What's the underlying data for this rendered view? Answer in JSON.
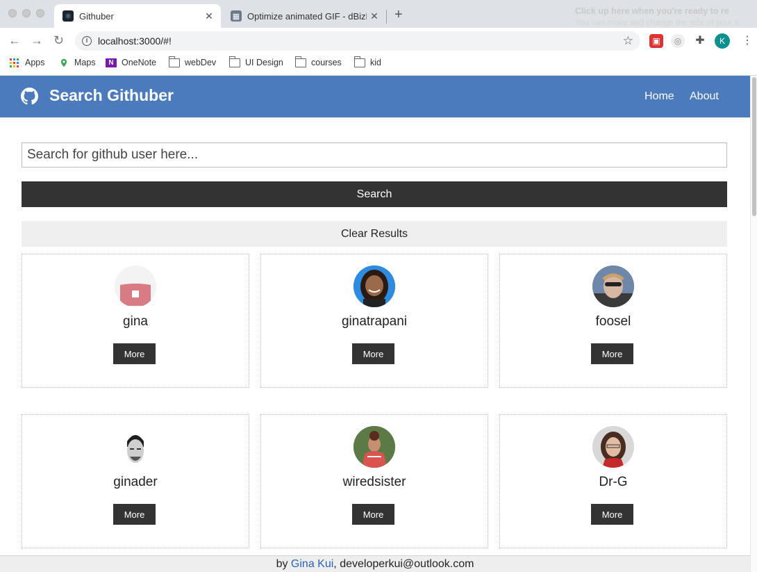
{
  "browser": {
    "tabs": [
      {
        "title": "Githuber",
        "active": true
      },
      {
        "title": "Optimize animated GIF - dBizE",
        "active": false
      }
    ],
    "overlay_text": "Click up here when you're ready to re",
    "overlay_text2": "You can move and change the size of your s",
    "url": "localhost:3000/#!",
    "profile_initial": "K",
    "bookmarks": [
      "Apps",
      "Maps",
      "OneNote",
      "webDev",
      "UI Design",
      "courses",
      "kid"
    ]
  },
  "header": {
    "title": "Search Githuber",
    "nav": [
      "Home",
      "About"
    ],
    "color": "#4b7bbd"
  },
  "search": {
    "placeholder": "Search for github user here...",
    "search_label": "Search",
    "clear_label": "Clear Results"
  },
  "results": [
    {
      "login": "gina",
      "more_label": "More"
    },
    {
      "login": "ginatrapani",
      "more_label": "More"
    },
    {
      "login": "foosel",
      "more_label": "More"
    },
    {
      "login": "ginader",
      "more_label": "More"
    },
    {
      "login": "wiredsister",
      "more_label": "More"
    },
    {
      "login": "Dr-G",
      "more_label": "More"
    }
  ],
  "footer": {
    "prefix": "by",
    "author": "Gina Kui",
    "email": ", developerkui@outlook.com"
  }
}
